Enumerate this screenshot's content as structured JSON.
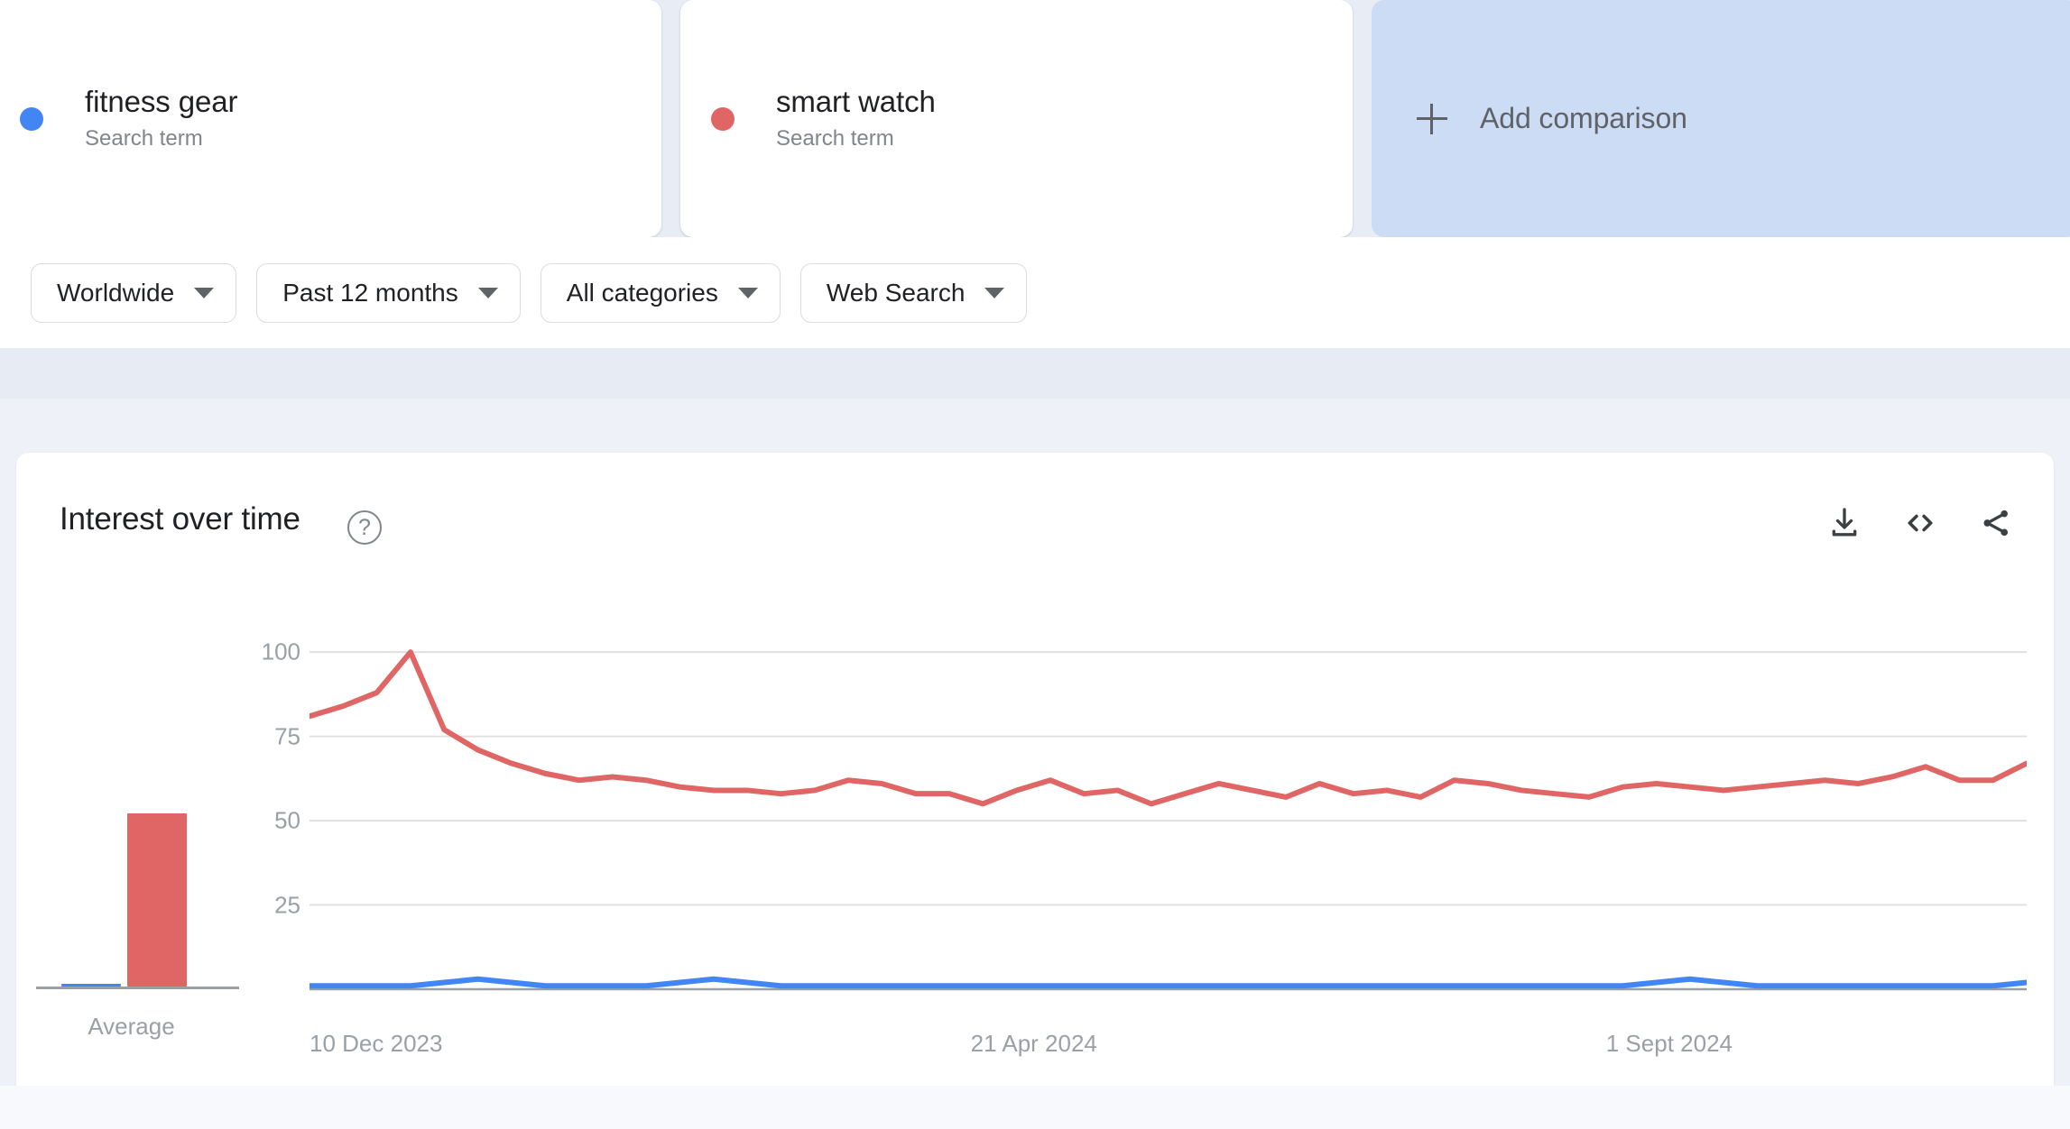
{
  "comparison": {
    "terms": [
      {
        "name": "fitness gear",
        "type_label": "Search term",
        "color": "#4285f4"
      },
      {
        "name": "smart watch",
        "type_label": "Search term",
        "color": "#e06666"
      }
    ],
    "add_comparison_label": "Add comparison"
  },
  "filters": [
    {
      "label": "Worldwide"
    },
    {
      "label": "Past 12 months"
    },
    {
      "label": "All categories"
    },
    {
      "label": "Web Search"
    }
  ],
  "chart_panel": {
    "title": "Interest over time",
    "help_glyph": "?",
    "actions": [
      {
        "name": "download",
        "label": "Download"
      },
      {
        "name": "embed",
        "label": "Embed"
      },
      {
        "name": "share",
        "label": "Share"
      }
    ]
  },
  "chart_data": {
    "type": "line",
    "title": "Interest over time",
    "xlabel": "",
    "ylabel": "",
    "ylim": [
      0,
      107
    ],
    "yticks": [
      25,
      50,
      75,
      100
    ],
    "ytick_labels": [
      "25",
      "50",
      "75",
      "100"
    ],
    "grid": true,
    "legend_position": "top-cards",
    "x_tick_labels": [
      "10 Dec 2023",
      "21 Apr 2024",
      "1 Sept 2024"
    ],
    "x_tick_positions": [
      0,
      0.385,
      0.755
    ],
    "x_start": "10 Dec 2023",
    "x_end": "Dec 2024",
    "series": [
      {
        "name": "fitness gear",
        "color": "#4285f4",
        "values": [
          1,
          1,
          1,
          1,
          2,
          3,
          2,
          1,
          1,
          1,
          1,
          2,
          3,
          2,
          1,
          1,
          1,
          1,
          1,
          1,
          1,
          1,
          1,
          1,
          1,
          1,
          1,
          1,
          1,
          1,
          1,
          1,
          1,
          1,
          1,
          1,
          1,
          1,
          1,
          1,
          2,
          3,
          2,
          1,
          1,
          1,
          1,
          1,
          1,
          1,
          1,
          2
        ]
      },
      {
        "name": "smart watch",
        "color": "#e06666",
        "values": [
          81,
          84,
          88,
          100,
          77,
          71,
          67,
          64,
          62,
          63,
          62,
          60,
          59,
          59,
          58,
          59,
          62,
          61,
          58,
          58,
          55,
          59,
          62,
          58,
          59,
          55,
          58,
          61,
          59,
          57,
          61,
          58,
          59,
          57,
          62,
          61,
          59,
          58,
          57,
          60,
          61,
          60,
          59,
          60,
          61,
          62,
          61,
          63,
          66,
          62,
          62,
          67
        ]
      }
    ],
    "average_bar": {
      "label": "Average",
      "bars": [
        {
          "name": "fitness gear",
          "value": 1,
          "color": "#4285f4"
        },
        {
          "name": "smart watch",
          "value": 62,
          "color": "#e06666"
        }
      ]
    }
  }
}
